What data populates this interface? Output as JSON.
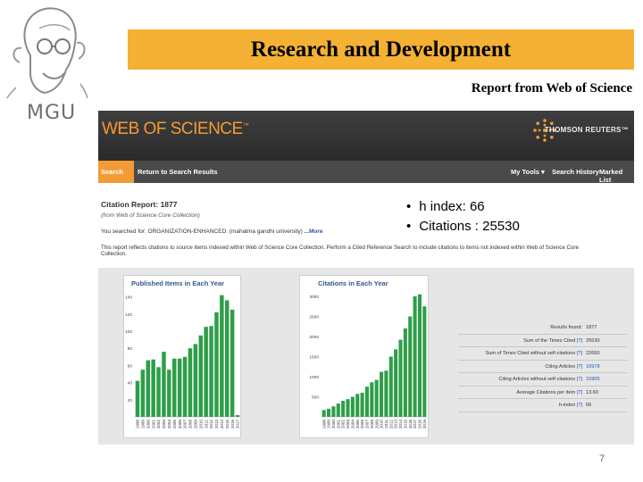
{
  "slide": {
    "title": "Research and Development",
    "subtitle": "Report from Web of Science",
    "logo_text": "MGU",
    "page_number": "7",
    "colors": {
      "title_bar": "#f4b133",
      "wos_orange": "#f39b35",
      "bar_green": "#2e9e48"
    }
  },
  "wos": {
    "brand": "WEB OF SCIENCE",
    "brand_tm": "™",
    "publisher": "THOMSON REUTERS™",
    "nav": {
      "search": "Search",
      "back": "Return to Search Results",
      "my_tools": "My Tools ▾",
      "history": "Search History",
      "marked": "Marked List"
    },
    "report_title": "Citation Report: 1877",
    "report_source": "(from Web of Science Core Collection)",
    "query": "You searched for: ORGANIZATION-ENHANCED: (mahatma gandhi university)",
    "query_more": "...More",
    "note": "This report reflects citations to source items indexed within Web of Science Core Collection. Perform a Cited Reference Search to include citations to items not indexed within Web of Science Core Collection.",
    "bullets": [
      "h index: 66",
      "Citations : 25530"
    ],
    "stats": [
      {
        "label": "Results found:",
        "link": "",
        "value": "1877",
        "link_value": false
      },
      {
        "label": "Sum of the Times Cited ",
        "link": "[?]",
        "value": "25530",
        "link_value": false
      },
      {
        "label": "Sum of Times Cited without self-citations ",
        "link": "[?]",
        "value": "22660",
        "link_value": false
      },
      {
        "label": "Citing Articles ",
        "link": "[?]",
        "value": "16978",
        "link_value": true
      },
      {
        "label": "Citing Articles without self-citations ",
        "link": "[?]",
        "value": "15905",
        "link_value": true
      },
      {
        "label": "Average Citations per item ",
        "link": "[?]",
        "value": "13.60",
        "link_value": false
      },
      {
        "label": "h-index ",
        "link": "[?]",
        "value": "66",
        "link_value": false
      }
    ]
  },
  "chart_data": [
    {
      "type": "bar",
      "title": "Published Items in Each Year",
      "xlabel": "",
      "ylabel": "",
      "categories": [
        "1998",
        "1999",
        "2000",
        "2001",
        "2002",
        "2003",
        "2004",
        "2005",
        "2006",
        "2007",
        "2008",
        "2009",
        "2010",
        "2011",
        "2012",
        "2013",
        "2014",
        "2015",
        "2016",
        "2017"
      ],
      "values": [
        42,
        55,
        66,
        67,
        58,
        76,
        55,
        68,
        68,
        70,
        80,
        85,
        95,
        105,
        106,
        122,
        142,
        136,
        125,
        2
      ],
      "ylim": [
        0,
        150
      ],
      "yticks": [
        "20",
        "40",
        "60",
        "80",
        "100",
        "120",
        "140"
      ],
      "grid": false
    },
    {
      "type": "bar",
      "title": "Citations in Each Year",
      "xlabel": "",
      "ylabel": "",
      "categories": [
        "1998",
        "1999",
        "2000",
        "2001",
        "2002",
        "2003",
        "2004",
        "2005",
        "2006",
        "2007",
        "2008",
        "2009",
        "2010",
        "2011",
        "2012",
        "2013",
        "2014",
        "2015",
        "2016",
        "2017",
        "2018",
        "2019"
      ],
      "values": [
        170,
        200,
        260,
        330,
        400,
        440,
        500,
        570,
        600,
        750,
        860,
        920,
        1120,
        1150,
        1500,
        1680,
        1920,
        2200,
        2500,
        3000,
        3050,
        2750
      ],
      "ylim": [
        0,
        3200
      ],
      "yticks": [
        "500",
        "1000",
        "1500",
        "2000",
        "2500",
        "3000"
      ],
      "grid": false
    }
  ]
}
